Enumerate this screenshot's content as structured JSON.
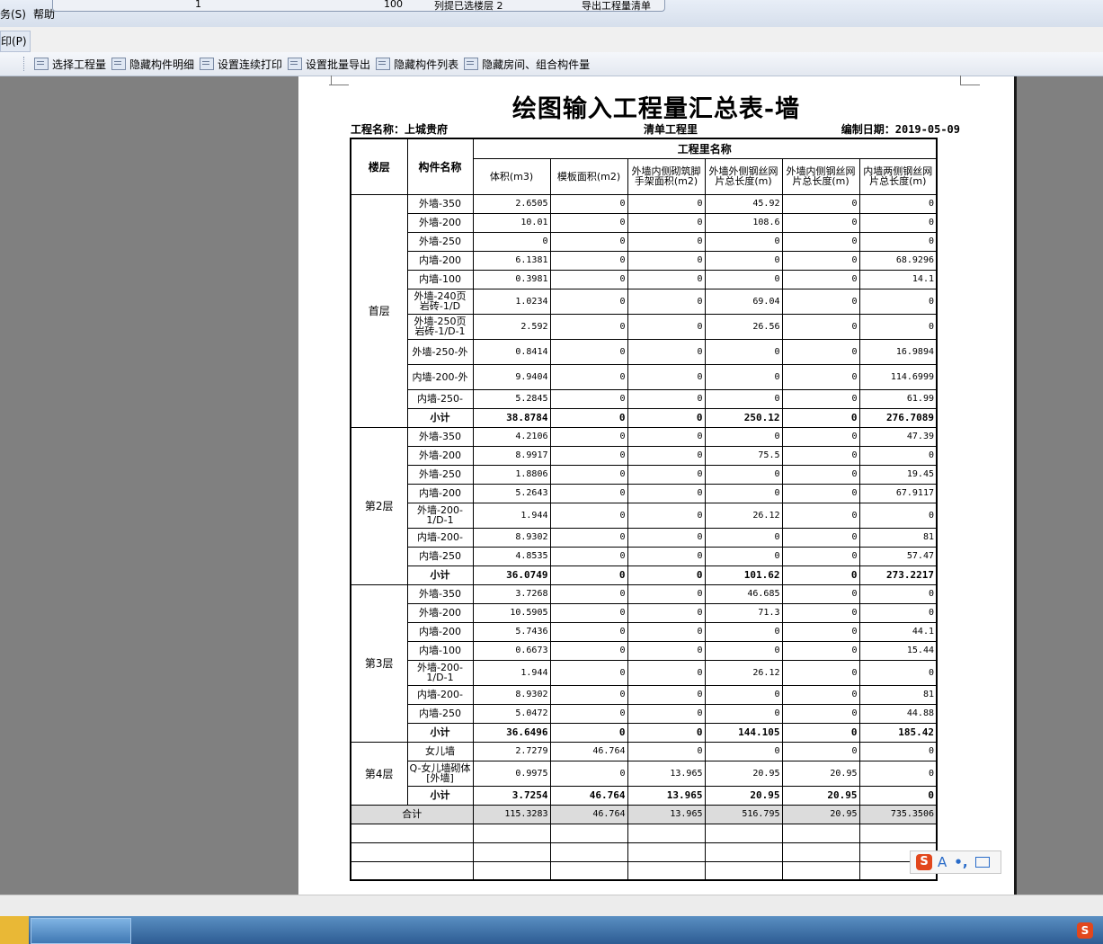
{
  "menu": {
    "service": "务(S)",
    "help": "帮助",
    "print_menu": "印(P)"
  },
  "floatbar": {
    "page_value": "1",
    "zoom_value": "100",
    "filter_text": "列提已选楼层 2",
    "export_btn": "导出工程量清单"
  },
  "toolbar": {
    "items": [
      "选择工程量",
      "隐藏构件明细",
      "设置连续打印",
      "设置批量导出",
      "隐藏构件列表",
      "隐藏房间、组合构件量"
    ]
  },
  "report": {
    "title": "绘图输入工程量汇总表-墙",
    "project_label": "工程名称：上城贵府",
    "list_label": "清单工程里",
    "date_label": "编制日期：2019-05-09",
    "col_floor": "楼层",
    "col_component": "构件名称",
    "col_group": "工程里名称",
    "col_headers": [
      "体积(m3)",
      "模板面积(m2)",
      "外墙内侧砌筑脚手架面积(m2)",
      "外墙外侧钢丝网片总长度(m)",
      "外墙内侧钢丝网片总长度(m)",
      "内墙两侧钢丝网片总长度(m)"
    ],
    "subtotal_label": "小计",
    "total_label": "合计",
    "groups": [
      {
        "floor": "首层",
        "rows": [
          {
            "name": "外墙-350",
            "v": [
              "2.6505",
              "0",
              "0",
              "45.92",
              "0",
              "0"
            ]
          },
          {
            "name": "外墙-200",
            "v": [
              "10.01",
              "0",
              "0",
              "108.6",
              "0",
              "0"
            ]
          },
          {
            "name": "外墙-250",
            "v": [
              "0",
              "0",
              "0",
              "0",
              "0",
              "0"
            ]
          },
          {
            "name": "内墙-200",
            "v": [
              "6.1381",
              "0",
              "0",
              "0",
              "0",
              "68.9296"
            ]
          },
          {
            "name": "内墙-100",
            "v": [
              "0.3981",
              "0",
              "0",
              "0",
              "0",
              "14.1"
            ]
          },
          {
            "name": "外墙-240页岩砖-1/D",
            "v": [
              "1.0234",
              "0",
              "0",
              "69.04",
              "0",
              "0"
            ]
          },
          {
            "name": "外墙-250页岩砖-1/D-1",
            "v": [
              "2.592",
              "0",
              "0",
              "26.56",
              "0",
              "0"
            ]
          },
          {
            "name": "外墙-250-外",
            "v": [
              "0.8414",
              "0",
              "0",
              "0",
              "0",
              "16.9894"
            ]
          },
          {
            "name": "内墙-200-外",
            "v": [
              "9.9404",
              "0",
              "0",
              "0",
              "0",
              "114.6999"
            ]
          },
          {
            "name": "内墙-250-",
            "v": [
              "5.2845",
              "0",
              "0",
              "0",
              "0",
              "61.99"
            ]
          }
        ],
        "subtotal": [
          "38.8784",
          "0",
          "0",
          "250.12",
          "0",
          "276.7089"
        ]
      },
      {
        "floor": "第2层",
        "rows": [
          {
            "name": "外墙-350",
            "v": [
              "4.2106",
              "0",
              "0",
              "0",
              "0",
              "47.39"
            ]
          },
          {
            "name": "外墙-200",
            "v": [
              "8.9917",
              "0",
              "0",
              "75.5",
              "0",
              "0"
            ]
          },
          {
            "name": "外墙-250",
            "v": [
              "1.8806",
              "0",
              "0",
              "0",
              "0",
              "19.45"
            ]
          },
          {
            "name": "内墙-200",
            "v": [
              "5.2643",
              "0",
              "0",
              "0",
              "0",
              "67.9117"
            ]
          },
          {
            "name": "外墙-200-1/D-1",
            "v": [
              "1.944",
              "0",
              "0",
              "26.12",
              "0",
              "0"
            ]
          },
          {
            "name": "内墙-200-",
            "v": [
              "8.9302",
              "0",
              "0",
              "0",
              "0",
              "81"
            ]
          },
          {
            "name": "内墙-250",
            "v": [
              "4.8535",
              "0",
              "0",
              "0",
              "0",
              "57.47"
            ]
          }
        ],
        "subtotal": [
          "36.0749",
          "0",
          "0",
          "101.62",
          "0",
          "273.2217"
        ]
      },
      {
        "floor": "第3层",
        "rows": [
          {
            "name": "外墙-350",
            "v": [
              "3.7268",
              "0",
              "0",
              "46.685",
              "0",
              "0"
            ]
          },
          {
            "name": "外墙-200",
            "v": [
              "10.5905",
              "0",
              "0",
              "71.3",
              "0",
              "0"
            ]
          },
          {
            "name": "内墙-200",
            "v": [
              "5.7436",
              "0",
              "0",
              "0",
              "0",
              "44.1"
            ]
          },
          {
            "name": "内墙-100",
            "v": [
              "0.6673",
              "0",
              "0",
              "0",
              "0",
              "15.44"
            ]
          },
          {
            "name": "外墙-200-1/D-1",
            "v": [
              "1.944",
              "0",
              "0",
              "26.12",
              "0",
              "0"
            ]
          },
          {
            "name": "内墙-200-",
            "v": [
              "8.9302",
              "0",
              "0",
              "0",
              "0",
              "81"
            ]
          },
          {
            "name": "内墙-250",
            "v": [
              "5.0472",
              "0",
              "0",
              "0",
              "0",
              "44.88"
            ]
          }
        ],
        "subtotal": [
          "36.6496",
          "0",
          "0",
          "144.105",
          "0",
          "185.42"
        ]
      },
      {
        "floor": "第4层",
        "rows": [
          {
            "name": "女儿墙",
            "v": [
              "2.7279",
              "46.764",
              "0",
              "0",
              "0",
              "0"
            ]
          },
          {
            "name": "Q-女儿墙砌体[外墙]",
            "v": [
              "0.9975",
              "0",
              "13.965",
              "20.95",
              "20.95",
              "0"
            ]
          }
        ],
        "subtotal": [
          "3.7254",
          "46.764",
          "13.965",
          "20.95",
          "20.95",
          "0"
        ]
      }
    ],
    "total": [
      "115.3283",
      "46.764",
      "13.965",
      "516.795",
      "20.95",
      "735.3506"
    ]
  },
  "ime": {
    "letter": "A",
    "dot": "•,",
    "logo": "S"
  },
  "tray": {
    "logo": "S"
  }
}
